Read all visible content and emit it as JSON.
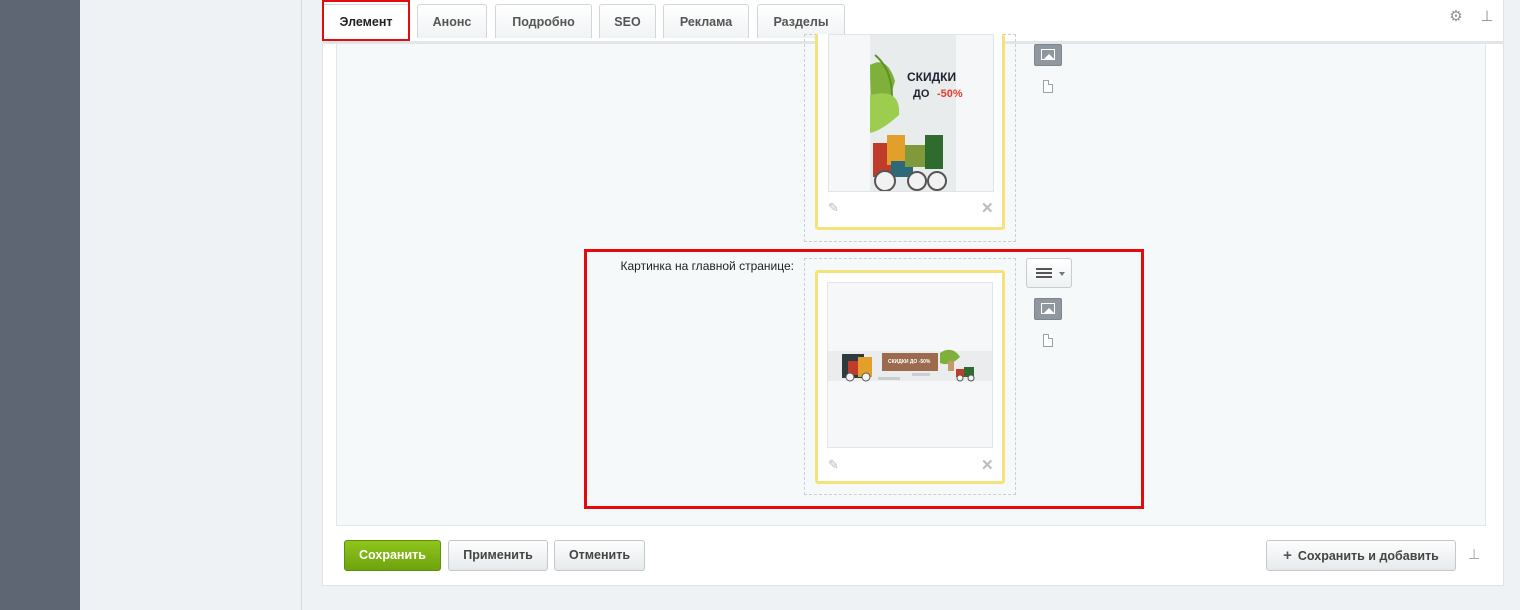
{
  "tabs": [
    "Элемент",
    "Анонс",
    "Подробно",
    "SEO",
    "Реклама",
    "Разделы"
  ],
  "toolbar": {
    "settings_icon": "gear-icon",
    "pin_icon": "pin-icon"
  },
  "banner_vertical": {
    "line1": "СКИДКИ",
    "line2": "ДО ",
    "discount": "-50%"
  },
  "banner_horizontal": {
    "text": "СКИДКИ ДО -50%"
  },
  "field": {
    "label": "Картинка на главной странице:"
  },
  "buttons": {
    "save": "Сохранить",
    "apply": "Применить",
    "cancel": "Отменить",
    "save_and_add": "Сохранить и добавить",
    "save_and_add_icon": "+"
  },
  "colors": {
    "accent_green": "#7db31a",
    "highlight_red": "#e30b0b",
    "frame_yellow": "#f6e27b"
  }
}
